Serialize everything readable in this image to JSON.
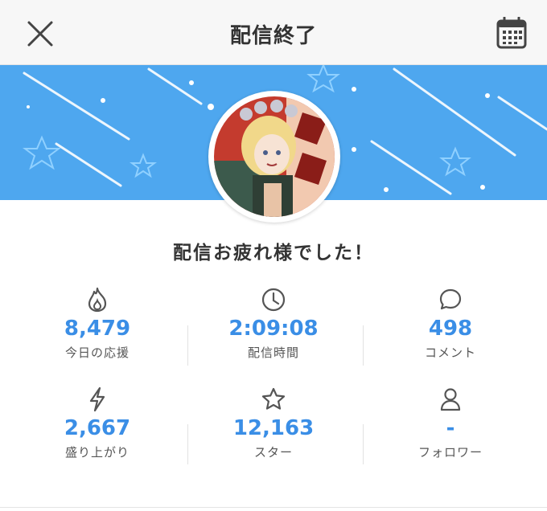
{
  "header": {
    "title": "配信終了",
    "close_icon": "close-icon",
    "calendar_icon": "calendar-icon"
  },
  "message": "配信お疲れ様でした！",
  "stats": [
    {
      "icon": "flame-icon",
      "value": "8,479",
      "label": "今日の応援"
    },
    {
      "icon": "clock-icon",
      "value": "2:09:08",
      "label": "配信時間"
    },
    {
      "icon": "speech-bubble-icon",
      "value": "498",
      "label": "コメント"
    },
    {
      "icon": "lightning-icon",
      "value": "2,667",
      "label": "盛り上がり"
    },
    {
      "icon": "star-icon",
      "value": "12,163",
      "label": "スター"
    },
    {
      "icon": "person-icon",
      "value": "-",
      "label": "フォロワー"
    }
  ],
  "colors": {
    "banner": "#4ea7ef",
    "value_text": "#3a8ee6",
    "header_bg": "#f7f7f7"
  }
}
